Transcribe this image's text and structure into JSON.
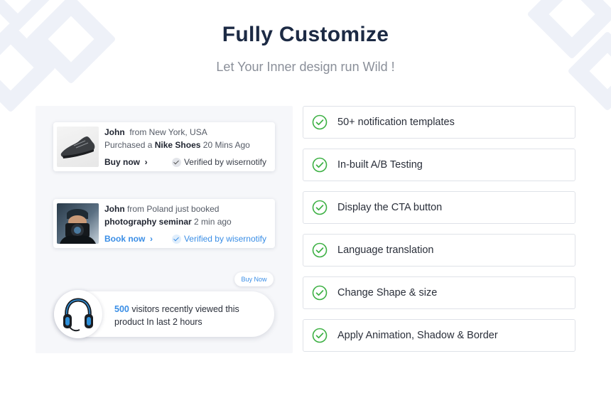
{
  "header": {
    "title": "Fully Customize",
    "subtitle": "Let Your Inner design run Wild !"
  },
  "notifications": [
    {
      "name": "John",
      "location": "from New York, USA",
      "action": "Purchased a",
      "item": "Nike Shoes",
      "time": "20 Mins Ago",
      "cta": "Buy now",
      "verified": "Verified by wisernotify",
      "thumb_icon": "sneaker-image"
    },
    {
      "name": "John",
      "location": "from Poland just booked",
      "item": "photography seminar",
      "time": "2 min ago",
      "cta": "Book now",
      "verified": "Verified by wisernotify",
      "thumb_icon": "photographer-image",
      "accent": "#3a8ee6"
    }
  ],
  "visitor_pill": {
    "chip_label": "Buy Now",
    "count": "500",
    "text_line1": " visitors recently viewed this",
    "text_line2": "product In last 2 hours",
    "thumb_icon": "headphones-image"
  },
  "features": [
    "50+ notification templates",
    "In-built A/B Testing",
    "Display the CTA button",
    "Language translation",
    "Change Shape & size",
    "Apply Animation, Shadow & Border"
  ],
  "colors": {
    "title": "#1c2a44",
    "accent_blue": "#3a8ee6",
    "check_green": "#3cb043",
    "panel_bg": "#f6f7fa"
  }
}
